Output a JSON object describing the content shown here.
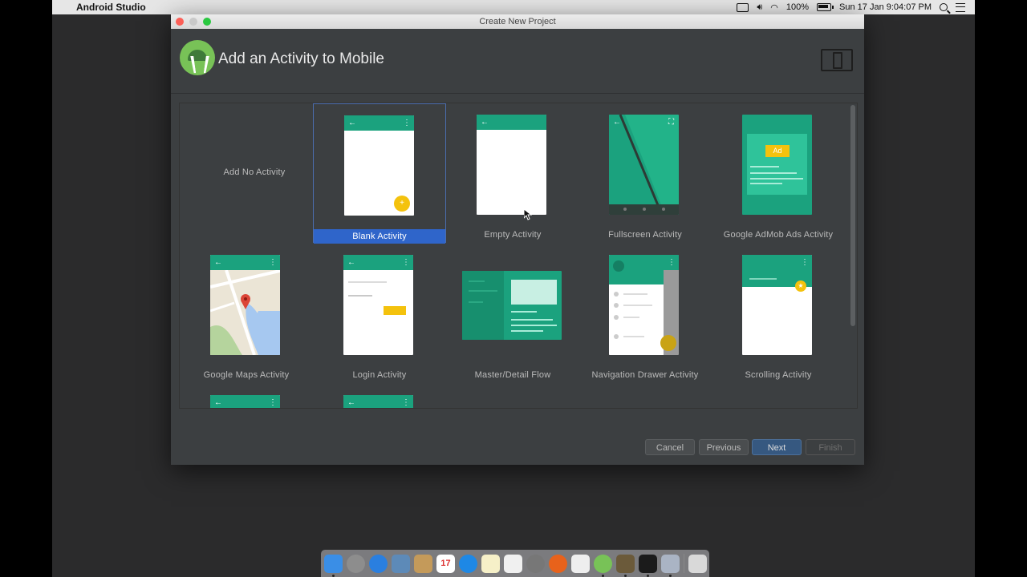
{
  "menubar": {
    "app_name": "Android Studio",
    "battery": "100%",
    "datetime": "Sun 17 Jan  9:04:07 PM"
  },
  "window": {
    "title": "Create New Project",
    "header_title": "Add an Activity to Mobile"
  },
  "gallery": {
    "selected": "Blank Activity",
    "items": [
      {
        "label": "Add No Activity"
      },
      {
        "label": "Blank Activity"
      },
      {
        "label": "Empty Activity"
      },
      {
        "label": "Fullscreen Activity"
      },
      {
        "label": "Google AdMob Ads Activity",
        "ad_badge": "Ad"
      },
      {
        "label": "Google Maps Activity"
      },
      {
        "label": "Login Activity"
      },
      {
        "label": "Master/Detail Flow"
      },
      {
        "label": "Navigation Drawer Activity"
      },
      {
        "label": "Scrolling Activity"
      }
    ]
  },
  "buttons": {
    "cancel": "Cancel",
    "previous": "Previous",
    "next": "Next",
    "finish": "Finish"
  },
  "colors": {
    "teal": "#1ba27e",
    "accent_yellow": "#f4c20d",
    "selection": "#2f65ca"
  },
  "dock": {
    "calendar_day": "17"
  }
}
